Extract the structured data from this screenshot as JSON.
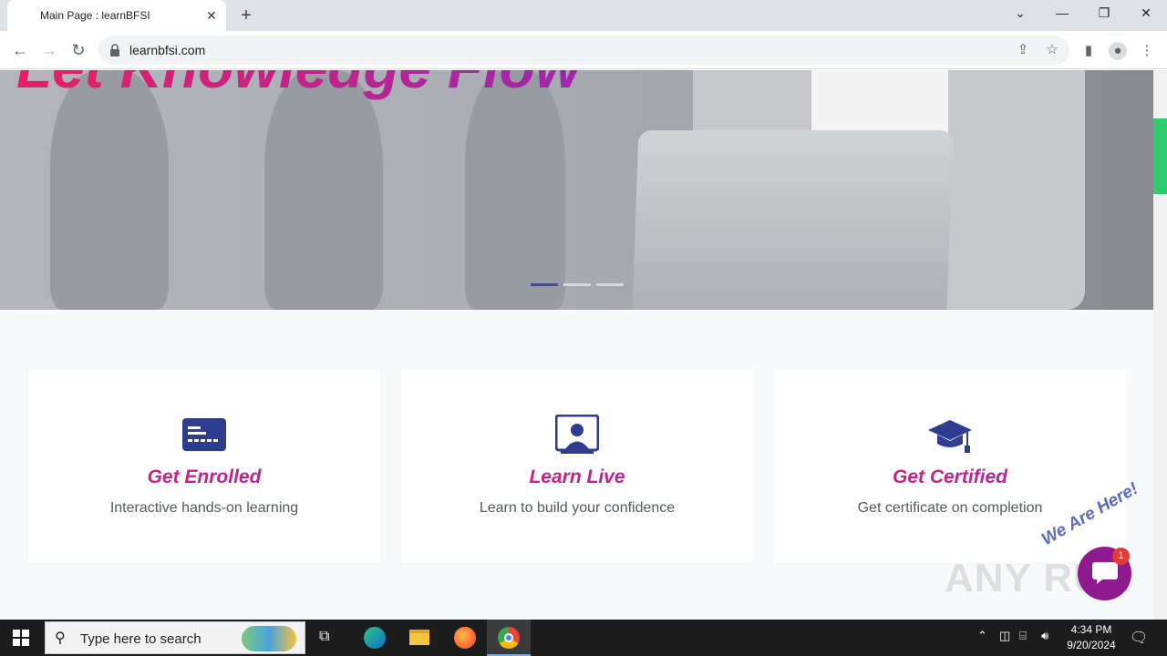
{
  "browser": {
    "tab_title": "Main Page : learnBFSI",
    "url": "learnbfsi.com"
  },
  "hero": {
    "title": "Let Knowledge Flow"
  },
  "cards": [
    {
      "title": "Get Enrolled",
      "desc": "Interactive hands-on learning",
      "icon": "id-card-icon"
    },
    {
      "title": "Learn Live",
      "desc": "Learn to build your confidence",
      "icon": "presentation-icon"
    },
    {
      "title": "Get Certified",
      "desc": "Get certificate on completion",
      "icon": "graduation-cap-icon"
    }
  ],
  "chat": {
    "label": "We Are Here!",
    "badge": "1"
  },
  "watermark": "ANY RUN",
  "taskbar": {
    "search_placeholder": "Type here to search",
    "time": "4:34 PM",
    "date": "9/20/2024"
  },
  "colors": {
    "accent_pink": "#e91e63",
    "accent_purple": "#9c27b0",
    "icon_blue": "#2e3d8f",
    "scroll_green": "#2ecc71"
  }
}
